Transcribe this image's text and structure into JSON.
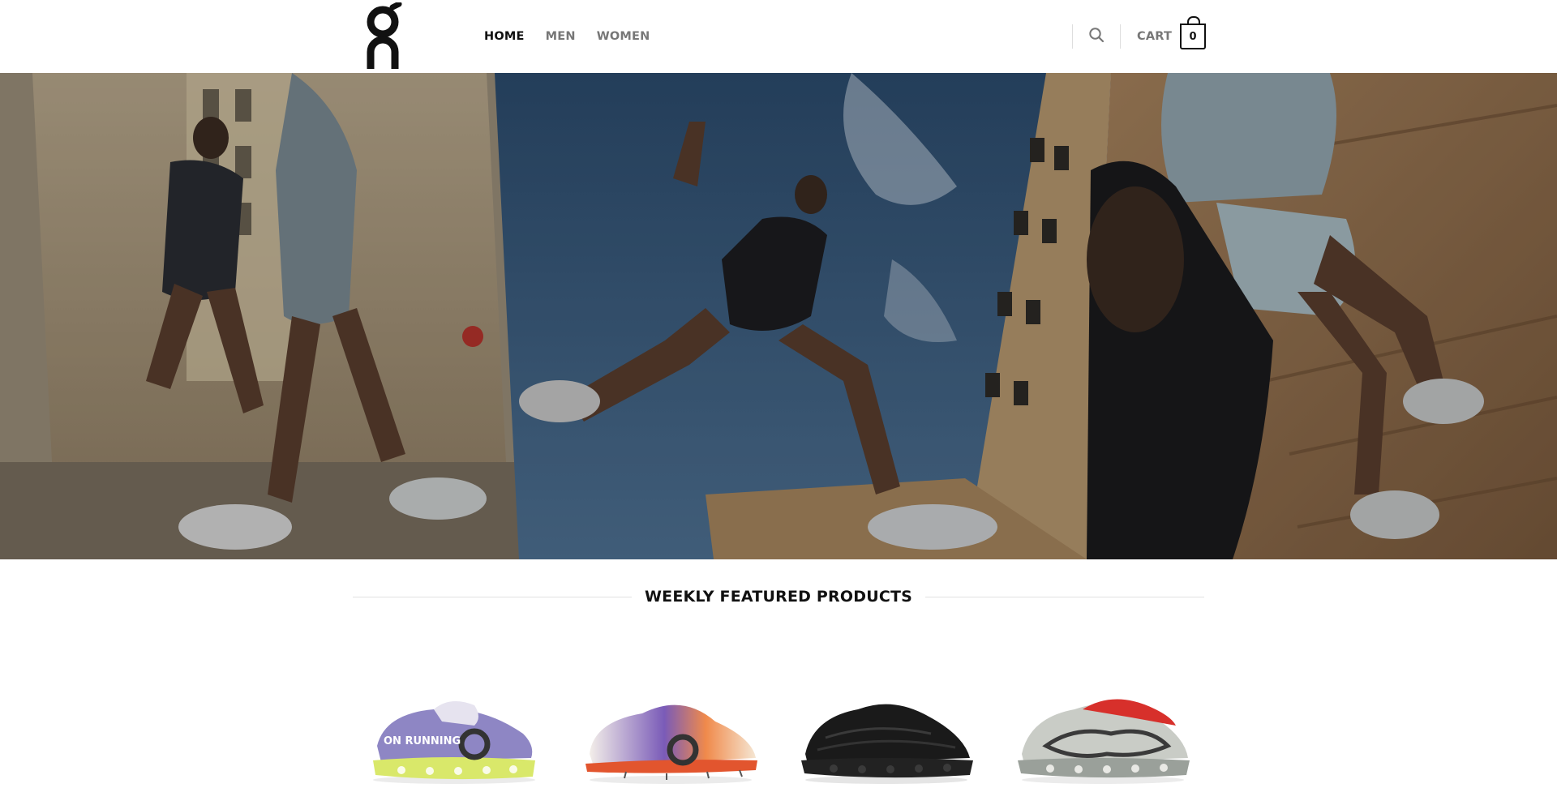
{
  "brand": {
    "logo_icon": "on-logo-icon"
  },
  "nav": {
    "items": [
      {
        "label": "HOME",
        "active": true
      },
      {
        "label": "MEN",
        "active": false
      },
      {
        "label": "WOMEN",
        "active": false
      }
    ]
  },
  "header_tools": {
    "search_icon": "search-icon",
    "cart_label": "CART",
    "cart_count": "0"
  },
  "hero": {
    "panels": [
      "runners-on-street",
      "runner-jumping",
      "runner-sitting-on-steps"
    ]
  },
  "featured": {
    "title": "WEEKLY FEATURED PRODUCTS",
    "products": [
      {
        "shoe_color": "#8e86c4",
        "sole_color": "#d9e86a",
        "print": "ON RUNNING"
      },
      {
        "shoe_color": "#e9e3ee",
        "sole_color": "#e2552e",
        "print": ""
      },
      {
        "shoe_color": "#1a1a1a",
        "sole_color": "#222222",
        "print": ""
      },
      {
        "shoe_color": "#c9ccc6",
        "sole_color": "#9aa09a",
        "print": ""
      }
    ]
  },
  "colors": {
    "accent": "#111111",
    "muted_nav": "#777777",
    "divider": "#e2e2e2"
  }
}
